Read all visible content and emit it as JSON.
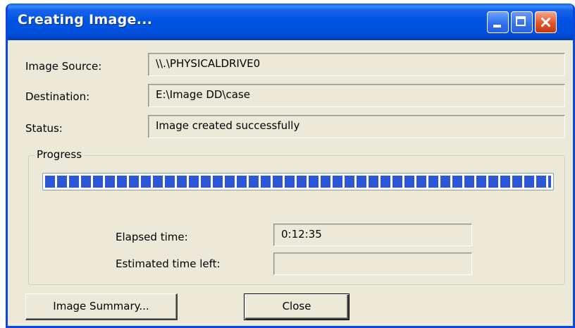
{
  "window": {
    "title": "Creating Image...",
    "accent_color": "#0054e3",
    "controls": {
      "minimize": "minimize-icon",
      "maximize": "maximize-icon",
      "close": "close-icon"
    }
  },
  "fields": {
    "image_source": {
      "label": "Image Source:",
      "value": "\\\\.\\PHYSICALDRIVE0"
    },
    "destination": {
      "label": "Destination:",
      "value": "E:\\Image DD\\case"
    },
    "status": {
      "label": "Status:",
      "value": "Image created successfully"
    }
  },
  "progress": {
    "label": "Progress",
    "fraction": 1.0,
    "color": "#2b56d6",
    "elapsed_label": "Elapsed time:",
    "elapsed_value": "0:12:35",
    "remaining_label": "Estimated time left:",
    "remaining_value": ""
  },
  "buttons": {
    "summary": "Image Summary...",
    "close": "Close"
  }
}
